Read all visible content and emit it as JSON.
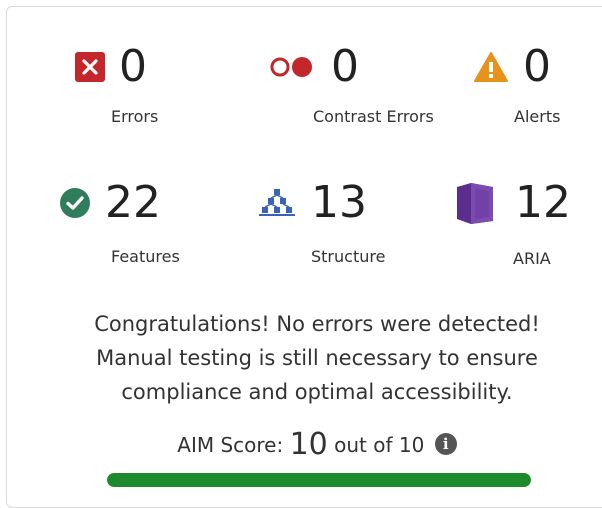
{
  "summary": {
    "errors": {
      "count": "0",
      "label": "Errors",
      "icon": "error-x-icon",
      "color": "#c3272b"
    },
    "contrast": {
      "count": "0",
      "label": "Contrast Errors",
      "icon": "contrast-icon",
      "color": "#c3272b"
    },
    "alerts": {
      "count": "0",
      "label": "Alerts",
      "icon": "alert-triangle-icon",
      "color": "#e5931b"
    },
    "features": {
      "count": "22",
      "label": "Features",
      "icon": "check-circle-icon",
      "color": "#2f7d5b"
    },
    "structure": {
      "count": "13",
      "label": "Structure",
      "icon": "structure-tree-icon",
      "color": "#3a62b8"
    },
    "aria": {
      "count": "12",
      "label": "ARIA",
      "icon": "aria-cube-icon",
      "color": "#5b2d8e"
    }
  },
  "message": {
    "line1": "Congratulations! No errors were detected!",
    "line2": "Manual testing is still necessary to ensure",
    "line3": "compliance and optimal accessibility."
  },
  "score": {
    "prefix": "AIM Score:",
    "value": "10",
    "suffix": "out of 10",
    "fraction": 1.0,
    "bar_color": "#1d8a2b"
  }
}
